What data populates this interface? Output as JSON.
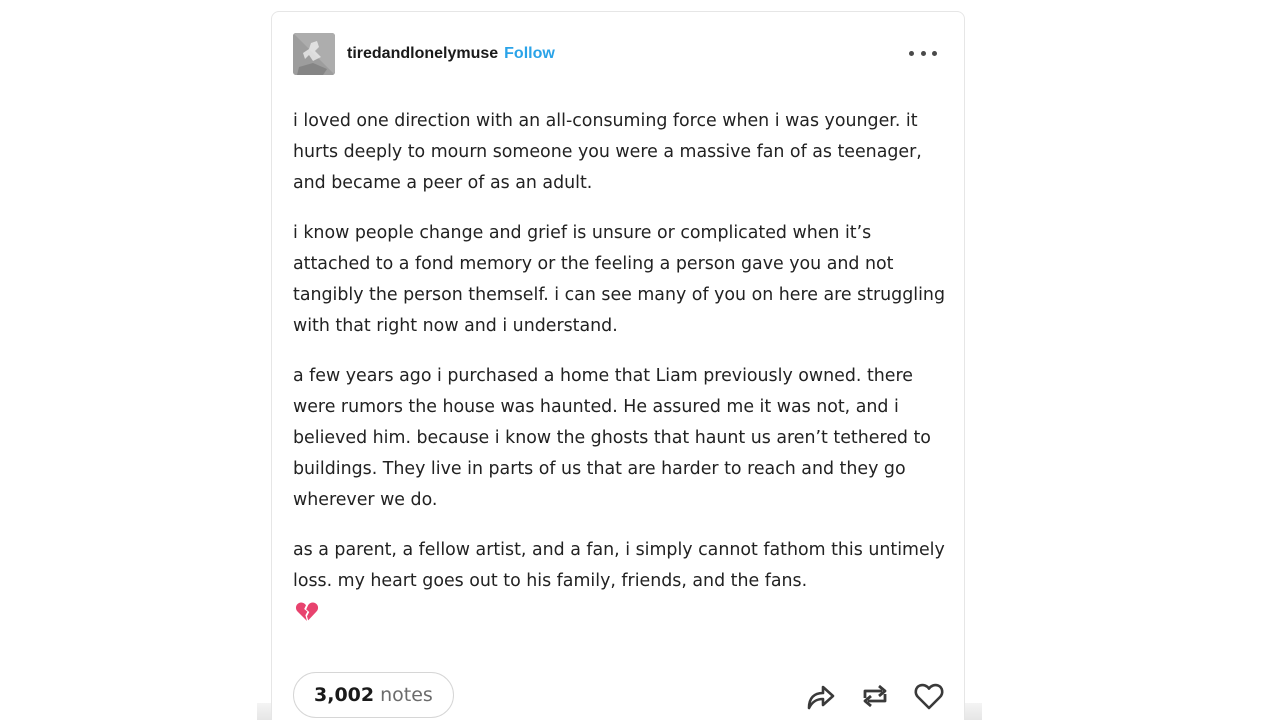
{
  "post": {
    "author": "tiredandlonelymuse",
    "follow_label": "Follow",
    "paragraphs": [
      "i loved one direction with an all-consuming force when i was younger. it hurts deeply to mourn someone you were a massive fan of as teenager, and became a peer of as an adult.",
      "i know people change and grief is unsure or complicated when it’s attached to a fond memory or the feeling a person gave you and not tangibly the person themself. i can see many of you on here are struggling with that right now and i understand.",
      "a few years ago i purchased a home that Liam previously owned. there were rumors the house was haunted. He assured me it was not, and i believed him. because i know the ghosts that haunt us aren’t tethered to buildings. They live in parts of us that are harder to reach and they go wherever we do.",
      "as a parent, a fellow artist, and a fan, i simply cannot fathom this untimely loss. my heart goes out to his family, friends, and the fans."
    ],
    "emoji": "💔"
  },
  "footer": {
    "notes_count": "3,002",
    "notes_label": "notes"
  },
  "icons": {
    "avatar": "avatar-image",
    "more": "more-options-icon",
    "share": "share-icon",
    "reblog": "reblog-icon",
    "like": "heart-icon",
    "emoji": "broken-heart-emoji"
  },
  "colors": {
    "follow": "#2aa3e8",
    "text": "#222222",
    "muted": "#6b6b6b",
    "emoji": "#e8436e"
  }
}
